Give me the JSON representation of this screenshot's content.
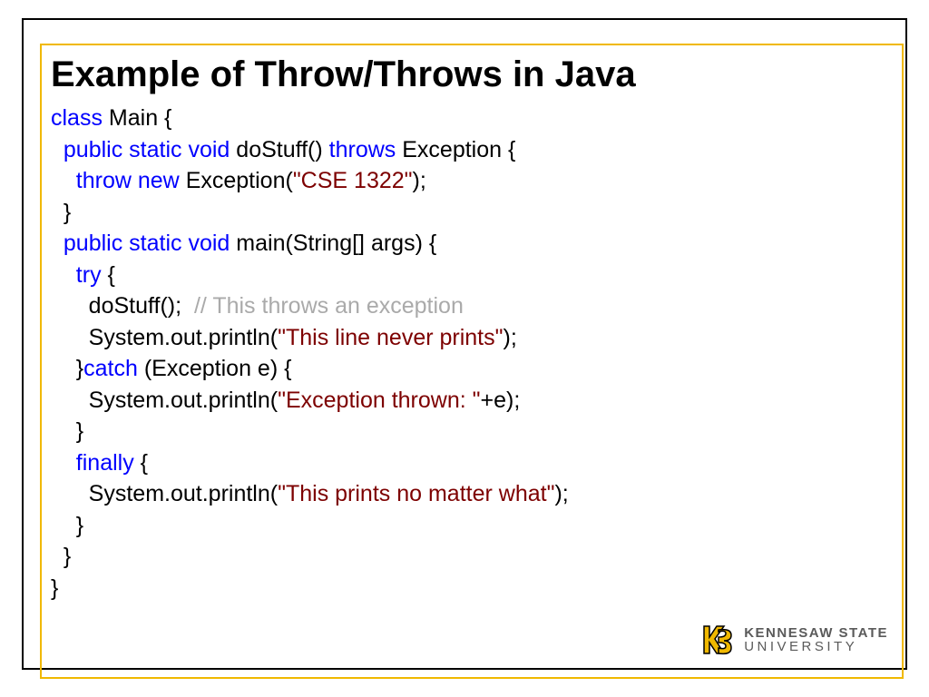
{
  "title": "Example of Throw/Throws in Java",
  "code": {
    "l1": {
      "kw": "class",
      "t": " Main {"
    },
    "l2": {
      "kw": "public static void",
      "t1": " doStuff() ",
      "kw2": "throws",
      "t2": " Exception {"
    },
    "l3": {
      "kw": "throw new",
      "t1": " Exception(",
      "s": "\"CSE 1322\"",
      "t2": ");"
    },
    "l4": {
      "t": "  }"
    },
    "l5": {
      "kw": "public static void",
      "t": " main(String[] args) {"
    },
    "l6": {
      "kw": "try",
      "t": " {"
    },
    "l7": {
      "t1": "      doStuff();  ",
      "c": "// This throws an exception"
    },
    "l8": {
      "t1": "      System.out.println(",
      "s": "\"This line never prints\"",
      "t2": ");"
    },
    "l9": {
      "t1": "    }",
      "kw": "catch",
      "t2": " (Exception e) {"
    },
    "l10": {
      "t1": "      System.out.println(",
      "s": "\"Exception thrown: \"",
      "t2": "+e);"
    },
    "l11": {
      "t": "    }"
    },
    "l12": {
      "kw": "finally",
      "t": " {"
    },
    "l13": {
      "t1": "      System.out.println(",
      "s": "\"This prints no matter what\"",
      "t2": ");"
    },
    "l14": {
      "t": "    }"
    },
    "l15": {
      "t": "  }"
    },
    "l16": {
      "t": "}"
    }
  },
  "logo": {
    "line1": "KENNESAW STATE",
    "line2": "UNIVERSITY"
  }
}
